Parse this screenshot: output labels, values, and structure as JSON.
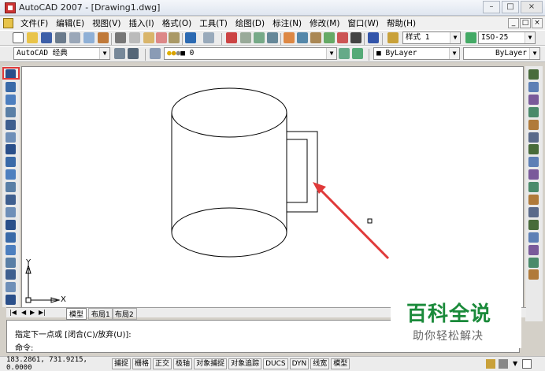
{
  "window": {
    "title": "AutoCAD 2007 - [Drawing1.dwg]",
    "buttons": [
      "–",
      "□",
      "×"
    ]
  },
  "menu": {
    "items": [
      "文件(F)",
      "编辑(E)",
      "视图(V)",
      "插入(I)",
      "格式(O)",
      "工具(T)",
      "绘图(D)",
      "标注(N)",
      "修改(M)",
      "窗口(W)",
      "帮助(H)"
    ],
    "mdi_buttons": [
      "_",
      "□",
      "×"
    ]
  },
  "toolbar_std": {
    "text_style": "样式 1",
    "dim_style": "ISO-25"
  },
  "toolbar_layers": {
    "workspace": "AutoCAD 经典",
    "layer": "0",
    "color": "ByLayer",
    "linetype": "ByLayer"
  },
  "draw_tools": [
    "line-icon",
    "construction-line-icon",
    "polyline-icon",
    "polygon-icon",
    "rectangle-icon",
    "arc-icon",
    "circle-icon",
    "revision-cloud-icon",
    "spline-icon",
    "ellipse-icon",
    "ellipse-arc-icon",
    "insert-block-icon",
    "make-block-icon",
    "point-icon",
    "hatch-icon",
    "gradient-icon",
    "region-icon",
    "table-icon",
    "mtext-icon"
  ],
  "modify_tools": [
    "erase-icon",
    "copy-icon",
    "mirror-icon",
    "offset-icon",
    "array-icon",
    "move-icon",
    "rotate-icon",
    "scale-icon",
    "stretch-icon",
    "trim-icon",
    "extend-icon",
    "break-at-point-icon",
    "break-icon",
    "join-icon",
    "chamfer-icon",
    "fillet-icon",
    "explode-icon"
  ],
  "ucs": {
    "x": "X",
    "y": "Y"
  },
  "tabs": [
    "模型",
    "布局1",
    "布局2"
  ],
  "command": {
    "prompt1": "指定下一点或 [闭合(C)/放弃(U)]:",
    "prompt2": "命令:"
  },
  "status": {
    "coords": "183.2861, 731.9215, 0.0000",
    "toggles": [
      "捕捉",
      "栅格",
      "正交",
      "极轴",
      "对象捕捉",
      "对象追踪",
      "DUCS",
      "DYN",
      "线宽",
      "模型"
    ]
  },
  "watermark": {
    "title": "百科全说",
    "subtitle": "助你轻松解决"
  },
  "colors": {
    "accent_red": "#e03a3a",
    "watermark_green": "#1a8a3a"
  }
}
